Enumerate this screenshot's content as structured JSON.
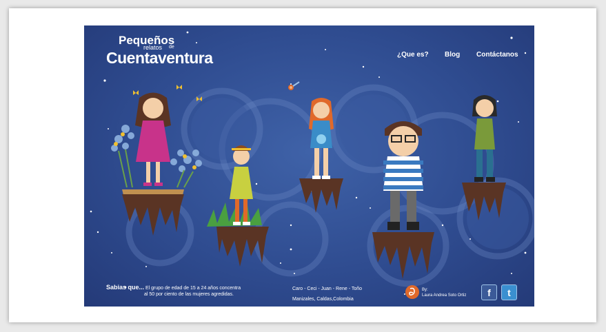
{
  "logo": {
    "line1": "Pequeños",
    "line2": "relatos",
    "line3": "de",
    "line4": "Cuentaventura"
  },
  "nav": {
    "que_es": "¿Que es?",
    "blog": "Blog",
    "contactanos": "Contáctanos"
  },
  "footer": {
    "sabias_title": "Sabias que...",
    "sabias_line1": "El grupo de edad de 15 a 24 años concentra",
    "sabias_line2": "al 50 por ciento de las mujeres agredidas.",
    "names": "Caro - Ceci - Juan - Rene - Toño",
    "location": "Manizales, Caldas,Colombia",
    "by_label": "By:",
    "author": "Laura Andrea Soto Ortiz"
  },
  "social": {
    "facebook_glyph": "f",
    "twitter_glyph": "t"
  },
  "colors": {
    "background": "#2f4c90",
    "accent_orange": "#e0692a",
    "ground": "#5a3424"
  }
}
